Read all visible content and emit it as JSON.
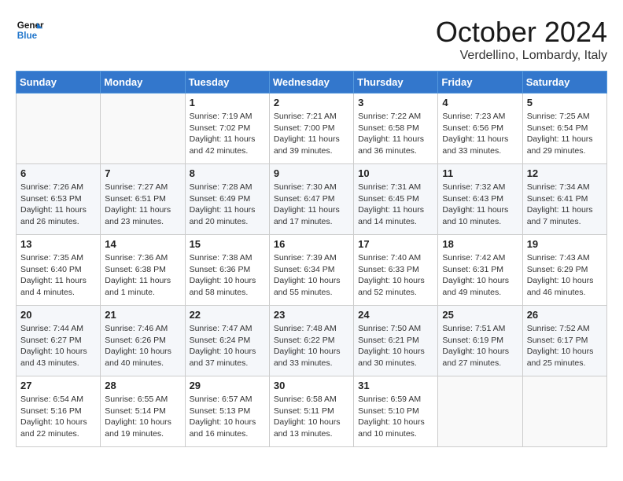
{
  "header": {
    "logo_line1": "General",
    "logo_line2": "Blue",
    "month_title": "October 2024",
    "location": "Verdellino, Lombardy, Italy"
  },
  "days_of_week": [
    "Sunday",
    "Monday",
    "Tuesday",
    "Wednesday",
    "Thursday",
    "Friday",
    "Saturday"
  ],
  "weeks": [
    [
      {
        "day": "",
        "info": ""
      },
      {
        "day": "",
        "info": ""
      },
      {
        "day": "1",
        "info": "Sunrise: 7:19 AM\nSunset: 7:02 PM\nDaylight: 11 hours and 42 minutes."
      },
      {
        "day": "2",
        "info": "Sunrise: 7:21 AM\nSunset: 7:00 PM\nDaylight: 11 hours and 39 minutes."
      },
      {
        "day": "3",
        "info": "Sunrise: 7:22 AM\nSunset: 6:58 PM\nDaylight: 11 hours and 36 minutes."
      },
      {
        "day": "4",
        "info": "Sunrise: 7:23 AM\nSunset: 6:56 PM\nDaylight: 11 hours and 33 minutes."
      },
      {
        "day": "5",
        "info": "Sunrise: 7:25 AM\nSunset: 6:54 PM\nDaylight: 11 hours and 29 minutes."
      }
    ],
    [
      {
        "day": "6",
        "info": "Sunrise: 7:26 AM\nSunset: 6:53 PM\nDaylight: 11 hours and 26 minutes."
      },
      {
        "day": "7",
        "info": "Sunrise: 7:27 AM\nSunset: 6:51 PM\nDaylight: 11 hours and 23 minutes."
      },
      {
        "day": "8",
        "info": "Sunrise: 7:28 AM\nSunset: 6:49 PM\nDaylight: 11 hours and 20 minutes."
      },
      {
        "day": "9",
        "info": "Sunrise: 7:30 AM\nSunset: 6:47 PM\nDaylight: 11 hours and 17 minutes."
      },
      {
        "day": "10",
        "info": "Sunrise: 7:31 AM\nSunset: 6:45 PM\nDaylight: 11 hours and 14 minutes."
      },
      {
        "day": "11",
        "info": "Sunrise: 7:32 AM\nSunset: 6:43 PM\nDaylight: 11 hours and 10 minutes."
      },
      {
        "day": "12",
        "info": "Sunrise: 7:34 AM\nSunset: 6:41 PM\nDaylight: 11 hours and 7 minutes."
      }
    ],
    [
      {
        "day": "13",
        "info": "Sunrise: 7:35 AM\nSunset: 6:40 PM\nDaylight: 11 hours and 4 minutes."
      },
      {
        "day": "14",
        "info": "Sunrise: 7:36 AM\nSunset: 6:38 PM\nDaylight: 11 hours and 1 minute."
      },
      {
        "day": "15",
        "info": "Sunrise: 7:38 AM\nSunset: 6:36 PM\nDaylight: 10 hours and 58 minutes."
      },
      {
        "day": "16",
        "info": "Sunrise: 7:39 AM\nSunset: 6:34 PM\nDaylight: 10 hours and 55 minutes."
      },
      {
        "day": "17",
        "info": "Sunrise: 7:40 AM\nSunset: 6:33 PM\nDaylight: 10 hours and 52 minutes."
      },
      {
        "day": "18",
        "info": "Sunrise: 7:42 AM\nSunset: 6:31 PM\nDaylight: 10 hours and 49 minutes."
      },
      {
        "day": "19",
        "info": "Sunrise: 7:43 AM\nSunset: 6:29 PM\nDaylight: 10 hours and 46 minutes."
      }
    ],
    [
      {
        "day": "20",
        "info": "Sunrise: 7:44 AM\nSunset: 6:27 PM\nDaylight: 10 hours and 43 minutes."
      },
      {
        "day": "21",
        "info": "Sunrise: 7:46 AM\nSunset: 6:26 PM\nDaylight: 10 hours and 40 minutes."
      },
      {
        "day": "22",
        "info": "Sunrise: 7:47 AM\nSunset: 6:24 PM\nDaylight: 10 hours and 37 minutes."
      },
      {
        "day": "23",
        "info": "Sunrise: 7:48 AM\nSunset: 6:22 PM\nDaylight: 10 hours and 33 minutes."
      },
      {
        "day": "24",
        "info": "Sunrise: 7:50 AM\nSunset: 6:21 PM\nDaylight: 10 hours and 30 minutes."
      },
      {
        "day": "25",
        "info": "Sunrise: 7:51 AM\nSunset: 6:19 PM\nDaylight: 10 hours and 27 minutes."
      },
      {
        "day": "26",
        "info": "Sunrise: 7:52 AM\nSunset: 6:17 PM\nDaylight: 10 hours and 25 minutes."
      }
    ],
    [
      {
        "day": "27",
        "info": "Sunrise: 6:54 AM\nSunset: 5:16 PM\nDaylight: 10 hours and 22 minutes."
      },
      {
        "day": "28",
        "info": "Sunrise: 6:55 AM\nSunset: 5:14 PM\nDaylight: 10 hours and 19 minutes."
      },
      {
        "day": "29",
        "info": "Sunrise: 6:57 AM\nSunset: 5:13 PM\nDaylight: 10 hours and 16 minutes."
      },
      {
        "day": "30",
        "info": "Sunrise: 6:58 AM\nSunset: 5:11 PM\nDaylight: 10 hours and 13 minutes."
      },
      {
        "day": "31",
        "info": "Sunrise: 6:59 AM\nSunset: 5:10 PM\nDaylight: 10 hours and 10 minutes."
      },
      {
        "day": "",
        "info": ""
      },
      {
        "day": "",
        "info": ""
      }
    ]
  ]
}
